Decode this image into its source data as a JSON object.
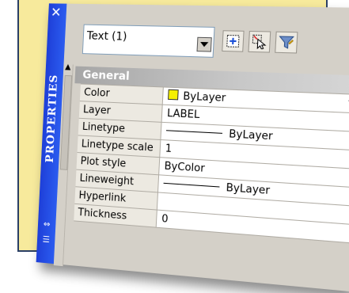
{
  "panel": {
    "title": "PROPERTIES",
    "close_glyph": "✕"
  },
  "selector": {
    "value": "Text (1)"
  },
  "toolbar": {
    "buttons": [
      {
        "icon": "toggle-pickadd-icon"
      },
      {
        "icon": "select-objects-icon"
      },
      {
        "icon": "quick-select-icon"
      }
    ]
  },
  "section": {
    "title": "General",
    "collapse_glyph": "⌃"
  },
  "rows": [
    {
      "label": "Color",
      "value": "ByLayer",
      "swatch_color": "#f5f000"
    },
    {
      "label": "Layer",
      "value": "LABEL"
    },
    {
      "label": "Linetype",
      "value": "ByLayer"
    },
    {
      "label": "Linetype scale",
      "value": "1"
    },
    {
      "label": "Plot style",
      "value": "ByColor"
    },
    {
      "label": "Lineweight",
      "value": "ByLayer"
    },
    {
      "label": "Hyperlink",
      "value": ""
    },
    {
      "label": "Thickness",
      "value": "0"
    }
  ]
}
